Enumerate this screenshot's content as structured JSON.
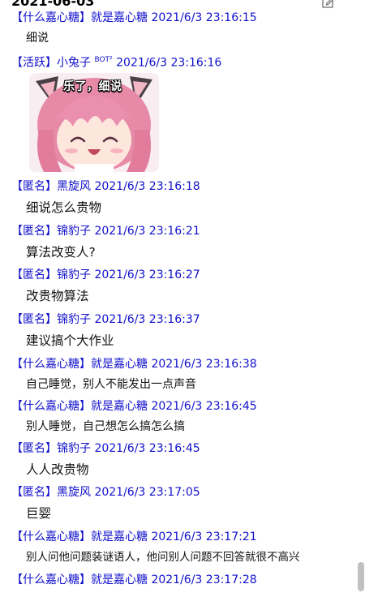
{
  "header": {
    "date": "2021-06-03"
  },
  "sticker": {
    "caption": "乐了，细说"
  },
  "messages": [
    {
      "tag": "【什么嘉心糖】",
      "name": "就是嘉心糖",
      "time": "2021/6/3 23:16:15",
      "text": "细说"
    },
    {
      "tag": "【活跃】",
      "name": "小兔子",
      "badge": "BOT²",
      "time": "2021/6/3 23:16:16",
      "text": ""
    },
    {
      "tag": "【匿名】",
      "name": "黑旋风",
      "time": "2021/6/3 23:16:18",
      "text": "细说怎么贵物"
    },
    {
      "tag": "【匿名】",
      "name": "锦豹子",
      "time": "2021/6/3 23:16:21",
      "text": "算法改变人?"
    },
    {
      "tag": "【匿名】",
      "name": "锦豹子",
      "time": "2021/6/3 23:16:27",
      "text": "改贵物算法"
    },
    {
      "tag": "【匿名】",
      "name": "锦豹子",
      "time": "2021/6/3 23:16:37",
      "text": "建议搞个大作业"
    },
    {
      "tag": "【什么嘉心糖】",
      "name": "就是嘉心糖",
      "time": "2021/6/3 23:16:38",
      "text": "自己睡觉，别人不能发出一点声音"
    },
    {
      "tag": "【什么嘉心糖】",
      "name": "就是嘉心糖",
      "time": "2021/6/3 23:16:45",
      "text": "别人睡觉，自己想怎么搞怎么搞"
    },
    {
      "tag": "【匿名】",
      "name": "锦豹子",
      "time": "2021/6/3 23:16:45",
      "text": "人人改贵物"
    },
    {
      "tag": "【匿名】",
      "name": "黑旋风",
      "time": "2021/6/3 23:17:05",
      "text": "巨婴"
    },
    {
      "tag": "【什么嘉心糖】",
      "name": "就是嘉心糖",
      "time": "2021/6/3 23:17:21",
      "text": "别人问他问题装谜语人，他问别人问题不回答就很不高兴"
    },
    {
      "tag": "【什么嘉心糖】",
      "name": "就是嘉心糖",
      "time": "2021/6/3 23:17:28",
      "text": ""
    }
  ]
}
